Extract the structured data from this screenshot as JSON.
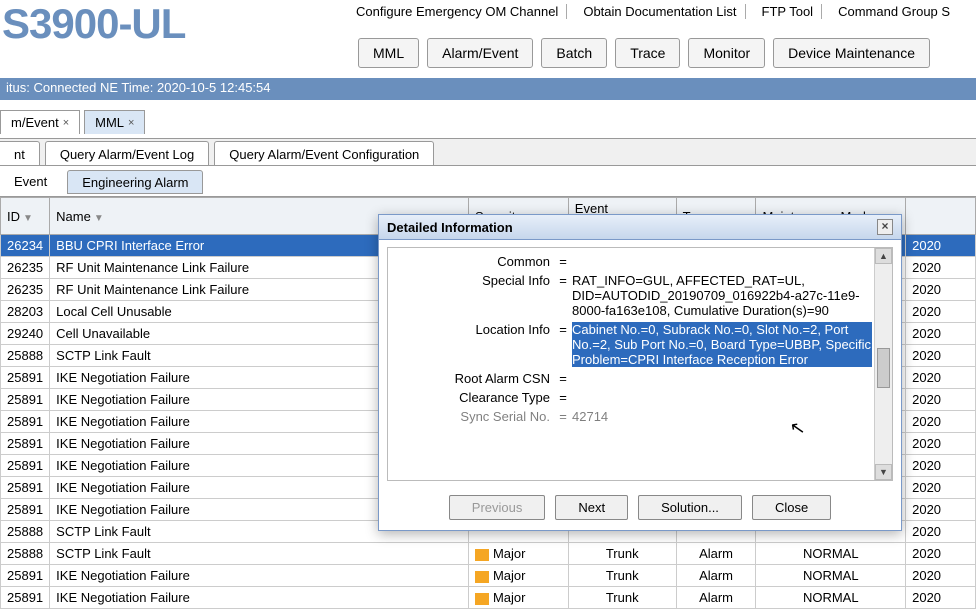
{
  "title": "S3900-UL",
  "topmenu": [
    "Configure Emergency OM Channel",
    "Obtain Documentation List",
    "FTP Tool",
    "Command Group S"
  ],
  "maintabs": [
    "MML",
    "Alarm/Event",
    "Batch",
    "Trace",
    "Monitor",
    "Device Maintenance"
  ],
  "status": "itus: Connected   NE Time: 2020-10-5 12:45:54",
  "doctabs": [
    {
      "label": "m/Event",
      "active": false
    },
    {
      "label": "MML",
      "active": true
    }
  ],
  "subtabs1": [
    {
      "label": "nt",
      "trunc": true
    },
    {
      "label": "Query Alarm/Event Log"
    },
    {
      "label": "Query Alarm/Event Configuration"
    }
  ],
  "subtabs2": [
    {
      "label": "Event",
      "active": false
    },
    {
      "label": "Engineering Alarm",
      "active": true
    }
  ],
  "columns": [
    "ID",
    "Name",
    "Severity",
    "Event Category",
    "Type",
    "Maintenance Mode",
    ""
  ],
  "rows": [
    {
      "id": "26234",
      "name": "BBU CPRI Interface Error",
      "sel": true,
      "date": "2020"
    },
    {
      "id": "26235",
      "name": "RF Unit Maintenance Link Failure",
      "date": "2020"
    },
    {
      "id": "26235",
      "name": "RF Unit Maintenance Link Failure",
      "date": "2020"
    },
    {
      "id": "28203",
      "name": "Local Cell Unusable",
      "date": "2020"
    },
    {
      "id": "29240",
      "name": "Cell Unavailable",
      "date": "2020"
    },
    {
      "id": "25888",
      "name": "SCTP Link Fault",
      "date": "2020"
    },
    {
      "id": "25891",
      "name": "IKE Negotiation Failure",
      "date": "2020"
    },
    {
      "id": "25891",
      "name": "IKE Negotiation Failure",
      "date": "2020"
    },
    {
      "id": "25891",
      "name": "IKE Negotiation Failure",
      "date": "2020"
    },
    {
      "id": "25891",
      "name": "IKE Negotiation Failure",
      "date": "2020"
    },
    {
      "id": "25891",
      "name": "IKE Negotiation Failure",
      "date": "2020"
    },
    {
      "id": "25891",
      "name": "IKE Negotiation Failure",
      "date": "2020"
    },
    {
      "id": "25891",
      "name": "IKE Negotiation Failure",
      "date": "2020"
    },
    {
      "id": "25888",
      "name": "SCTP Link Fault",
      "date": "2020"
    },
    {
      "id": "25888",
      "name": "SCTP Link Fault",
      "sev": "Major",
      "cat": "Trunk",
      "type": "Alarm",
      "mm": "NORMAL",
      "date": "2020"
    },
    {
      "id": "25891",
      "name": "IKE Negotiation Failure",
      "sev": "Major",
      "cat": "Trunk",
      "type": "Alarm",
      "mm": "NORMAL",
      "date": "2020"
    },
    {
      "id": "25891",
      "name": "IKE Negotiation Failure",
      "sev": "Major",
      "cat": "Trunk",
      "type": "Alarm",
      "mm": "NORMAL",
      "date": "2020"
    }
  ],
  "dialog": {
    "title": "Detailed Information",
    "rows": [
      {
        "label": "Common",
        "val": ""
      },
      {
        "label": "Special Info",
        "val": "RAT_INFO=GUL, AFFECTED_RAT=UL, DID=AUTODID_20190709_016922b4-a27c-11e9-8000-fa163e108, Cumulative Duration(s)=90"
      },
      {
        "label": "Location Info",
        "val": "Cabinet No.=0, Subrack No.=0, Slot No.=2, Port No.=2, Sub Port No.=0, Board Type=UBBP, Specific Problem=CPRI Interface Reception Error",
        "sel": true
      },
      {
        "label": "Root Alarm CSN",
        "val": ""
      },
      {
        "label": "Clearance Type",
        "val": ""
      },
      {
        "label": "Sync Serial No.",
        "val": "42714",
        "cut": true
      }
    ],
    "btns": {
      "prev": "Previous",
      "next": "Next",
      "sol": "Solution...",
      "close": "Close"
    }
  }
}
